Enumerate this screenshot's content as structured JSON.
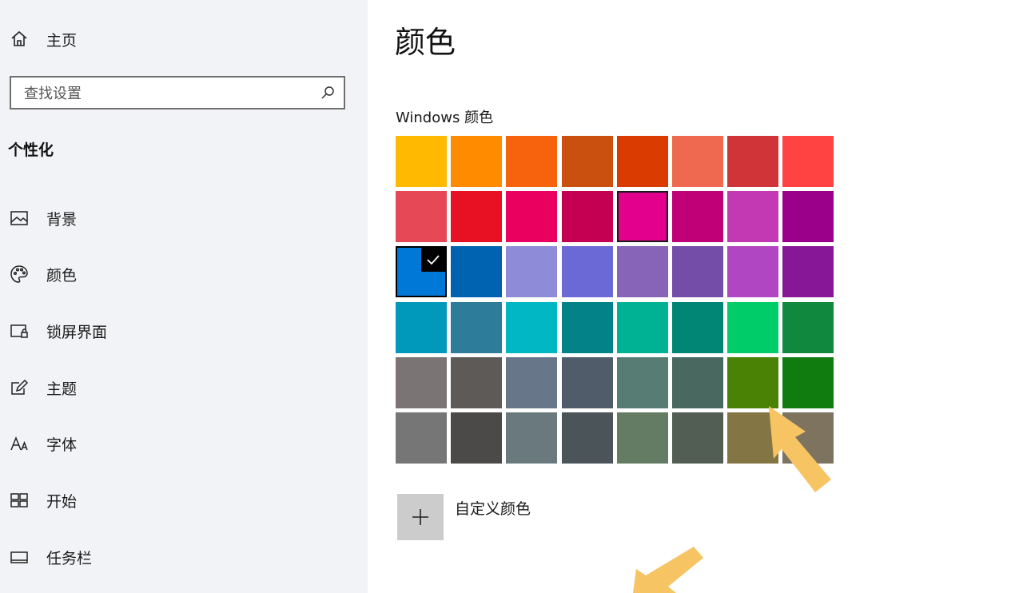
{
  "sidebar": {
    "home_label": "主页",
    "search_placeholder": "查找设置",
    "section_title": "个性化",
    "items": [
      {
        "label": "背景",
        "icon": "picture-icon"
      },
      {
        "label": "颜色",
        "icon": "palette-icon"
      },
      {
        "label": "锁屏界面",
        "icon": "lock-screen-icon"
      },
      {
        "label": "主题",
        "icon": "theme-icon"
      },
      {
        "label": "字体",
        "icon": "font-icon"
      },
      {
        "label": "开始",
        "icon": "start-icon"
      },
      {
        "label": "任务栏",
        "icon": "taskbar-icon"
      }
    ]
  },
  "main": {
    "title": "颜色",
    "palette_label": "Windows 颜色",
    "custom_color_label": "自定义颜色"
  },
  "palette": {
    "rows": [
      [
        "#FFB900",
        "#FF8C00",
        "#F7630C",
        "#CA5010",
        "#DA3B01",
        "#EF6950",
        "#D13438",
        "#FF4343"
      ],
      [
        "#E74856",
        "#E81123",
        "#EA005E",
        "#C30052",
        "#E3008C",
        "#BF0077",
        "#C239B3",
        "#9A0089"
      ],
      [
        "#0078D7",
        "#0063B1",
        "#8E8CD8",
        "#6B69D6",
        "#8764B8",
        "#744DA9",
        "#B146C2",
        "#881798"
      ],
      [
        "#0099BC",
        "#2D7D9A",
        "#00B7C3",
        "#038387",
        "#00B294",
        "#018574",
        "#00CC6A",
        "#10893E"
      ],
      [
        "#7A7574",
        "#5D5A58",
        "#68768A",
        "#515C6B",
        "#567C73",
        "#486860",
        "#498205",
        "#107C10"
      ],
      [
        "#767676",
        "#4C4A48",
        "#69797E",
        "#4A5459",
        "#647C64",
        "#525E54",
        "#847545",
        "#7E735F"
      ]
    ],
    "selected": [
      2,
      0
    ],
    "hovered": [
      1,
      4
    ]
  },
  "colors": {
    "sidebar_bg": "#F1F3F6",
    "annotation_arrow": "#F6C463"
  }
}
